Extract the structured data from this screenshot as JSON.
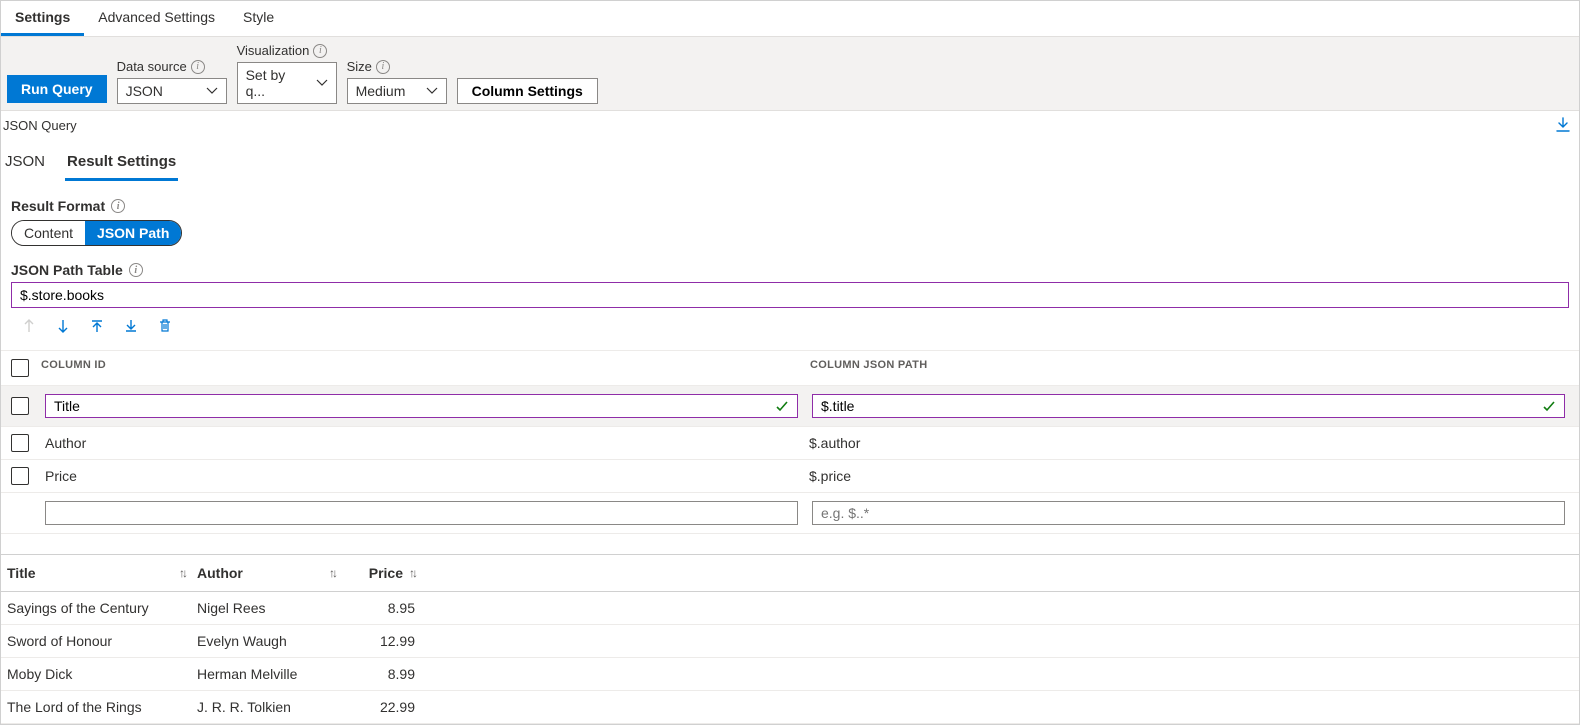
{
  "tabs": {
    "settings": "Settings",
    "advanced": "Advanced Settings",
    "style": "Style"
  },
  "toolbar": {
    "run": "Run Query",
    "datasource_label": "Data source",
    "datasource_value": "JSON",
    "visualization_label": "Visualization",
    "visualization_value": "Set by q...",
    "size_label": "Size",
    "size_value": "Medium",
    "column_settings": "Column Settings"
  },
  "query_section": "JSON Query",
  "subtabs": {
    "json": "JSON",
    "result": "Result Settings"
  },
  "result_format": {
    "label": "Result Format",
    "content": "Content",
    "jsonpath": "JSON Path"
  },
  "path_table": {
    "label": "JSON Path Table",
    "value": "$.store.books"
  },
  "columns": {
    "id_header": "COLUMN ID",
    "path_header": "COLUMN JSON PATH",
    "rows": [
      {
        "id": "Title",
        "path": "$.title",
        "editing": true
      },
      {
        "id": "Author",
        "path": "$.author",
        "editing": false
      },
      {
        "id": "Price",
        "path": "$.price",
        "editing": false
      }
    ],
    "new_id_placeholder": "",
    "new_path_placeholder": "e.g. $..*"
  },
  "results": {
    "headers": {
      "title": "Title",
      "author": "Author",
      "price": "Price"
    },
    "rows": [
      {
        "title": "Sayings of the Century",
        "author": "Nigel Rees",
        "price": "8.95"
      },
      {
        "title": "Sword of Honour",
        "author": "Evelyn Waugh",
        "price": "12.99"
      },
      {
        "title": "Moby Dick",
        "author": "Herman Melville",
        "price": "8.99"
      },
      {
        "title": "The Lord of the Rings",
        "author": "J. R. R. Tolkien",
        "price": "22.99"
      }
    ]
  }
}
